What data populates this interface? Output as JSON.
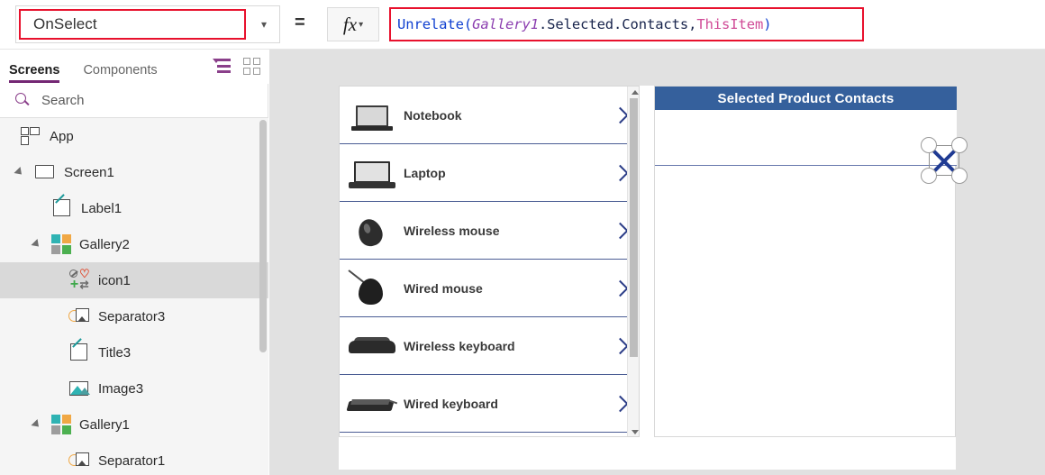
{
  "formula_bar": {
    "property_value": "OnSelect",
    "property_caret_icon": "chevron-down-icon",
    "equals_sign": "=",
    "fx_label": "fx",
    "fx_caret_icon": "chevron-down-icon",
    "formula_full": "Unrelate( Gallery1.Selected.Contacts, ThisItem )",
    "tokens": {
      "fn": "Unrelate(",
      "control": "Gallery1",
      "member": ".Selected.Contacts,",
      "this_item": "ThisItem",
      "close_paren": ")"
    },
    "colors": {
      "focus_border": "#e8112d",
      "fn": "#0f3fd0",
      "control": "#8c3fb0",
      "member": "#18244c",
      "this_item": "#d04a96"
    }
  },
  "sidebar": {
    "tabs": [
      {
        "label": "Screens",
        "active": true
      },
      {
        "label": "Components",
        "active": false
      }
    ],
    "view_buttons": [
      {
        "name": "tree-view-icon"
      },
      {
        "name": "thumbnail-view-icon"
      }
    ],
    "search": {
      "placeholder": "Search",
      "value": "",
      "icon": "search-icon"
    },
    "accent_color": "#742774",
    "tree": [
      {
        "label": "App",
        "icon": "app-icon",
        "indent": 22,
        "twisty": false,
        "selected": false
      },
      {
        "label": "Screen1",
        "icon": "screen-icon",
        "indent": 38,
        "twisty": true,
        "selected": false
      },
      {
        "label": "Label1",
        "icon": "label-icon",
        "indent": 57,
        "twisty": false,
        "selected": false
      },
      {
        "label": "Gallery2",
        "icon": "gallery-icon",
        "indent": 57,
        "twisty": true,
        "selected": false
      },
      {
        "label": "icon1",
        "icon": "relate-icon",
        "indent": 76,
        "twisty": false,
        "selected": true
      },
      {
        "label": "Separator3",
        "icon": "separator-icon",
        "indent": 76,
        "twisty": false,
        "selected": false
      },
      {
        "label": "Title3",
        "icon": "label-icon",
        "indent": 76,
        "twisty": false,
        "selected": false
      },
      {
        "label": "Image3",
        "icon": "image-icon",
        "indent": 76,
        "twisty": false,
        "selected": false
      },
      {
        "label": "Gallery1",
        "icon": "gallery-icon",
        "indent": 57,
        "twisty": true,
        "selected": false
      },
      {
        "label": "Separator1",
        "icon": "separator-icon",
        "indent": 76,
        "twisty": false,
        "selected": false
      }
    ]
  },
  "canvas": {
    "gallery1": {
      "name": "Gallery1",
      "items": [
        {
          "name": "Notebook",
          "pic": "notebook-image",
          "chevron": "chevron-right-icon"
        },
        {
          "name": "Laptop",
          "pic": "laptop-image",
          "chevron": "chevron-right-icon"
        },
        {
          "name": "Wireless mouse",
          "pic": "wireless-mouse-image",
          "chevron": "chevron-right-icon"
        },
        {
          "name": "Wired mouse",
          "pic": "wired-mouse-image",
          "chevron": "chevron-right-icon"
        },
        {
          "name": "Wireless keyboard",
          "pic": "wireless-keyboard-image",
          "chevron": "chevron-right-icon"
        },
        {
          "name": "Wired keyboard",
          "pic": "wired-keyboard-image",
          "chevron": "chevron-right-icon"
        }
      ],
      "scrollbar": {
        "up_icon": "scroll-up-arrow-icon",
        "down_icon": "scroll-down-arrow-icon"
      }
    },
    "gallery2": {
      "name": "Gallery2",
      "header_title": "Selected Product Contacts",
      "header_color": "#35609c",
      "separator_color": "#6677ac",
      "rows": []
    },
    "selection": {
      "selected_control": "icon1",
      "icon": "unrelate-x-icon",
      "handle_count": 4,
      "x_color": "#1f3a93"
    }
  }
}
